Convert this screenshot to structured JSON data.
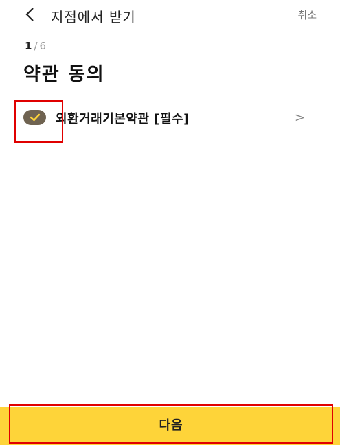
{
  "header": {
    "back_icon": "chevron-left-icon",
    "title": "지점에서 받기",
    "cancel_label": "취소"
  },
  "progress": {
    "current": "1",
    "separator": "/",
    "total": "6"
  },
  "page_title": "약관 동의",
  "terms": [
    {
      "label": "외환거래기본약관 [필수]",
      "checked": true,
      "arrow": ">"
    }
  ],
  "footer": {
    "next_label": "다음"
  },
  "colors": {
    "accent_yellow": "#fed439",
    "check_fill": "#6f6351",
    "check_mark": "#fed439",
    "highlight": "#e00000"
  }
}
